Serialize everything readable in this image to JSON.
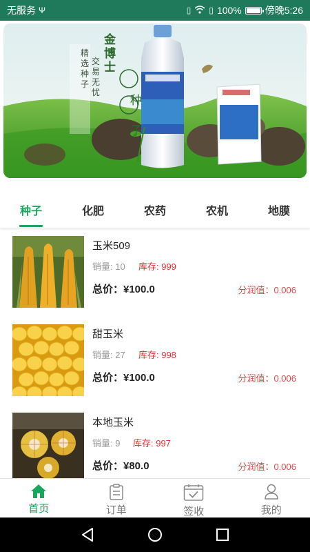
{
  "status_bar": {
    "carrier": "无服务",
    "battery": "100%",
    "time": "傍晚5:26"
  },
  "banner": {
    "brand": "金博士",
    "product": "种子",
    "slogan_line1": "精选种子",
    "slogan_line2": "交易无忧"
  },
  "tabs": [
    {
      "label": "种子",
      "active": true
    },
    {
      "label": "化肥",
      "active": false
    },
    {
      "label": "农药",
      "active": false
    },
    {
      "label": "农机",
      "active": false
    },
    {
      "label": "地膜",
      "active": false
    }
  ],
  "products": [
    {
      "name": "玉米509",
      "sales": "销量: 10",
      "stock": "库存: 999",
      "total": "总价：¥100.0",
      "profit": "分润值：0.006",
      "image": "corn-ears-photo"
    },
    {
      "name": "甜玉米",
      "sales": "销量: 27",
      "stock": "库存: 998",
      "total": "总价：¥100.0",
      "profit": "分润值：0.006",
      "image": "sweet-corn-photo"
    },
    {
      "name": "本地玉米",
      "sales": "销量: 9",
      "stock": "库存: 997",
      "total": "总价：¥80.0",
      "profit": "分润值：0.006",
      "image": "corn-cross-section-photo"
    }
  ],
  "bottom_nav": [
    {
      "label": "首页",
      "icon": "home-icon",
      "active": true
    },
    {
      "label": "订单",
      "icon": "clipboard-icon",
      "active": false
    },
    {
      "label": "签收",
      "icon": "calendar-check-icon",
      "active": false
    },
    {
      "label": "我的",
      "icon": "user-icon",
      "active": false
    }
  ],
  "colors": {
    "status_bar": "#1e7a5a",
    "accent": "#1aa65c",
    "stock_red": "#e03030",
    "profit_red": "#e04848"
  }
}
